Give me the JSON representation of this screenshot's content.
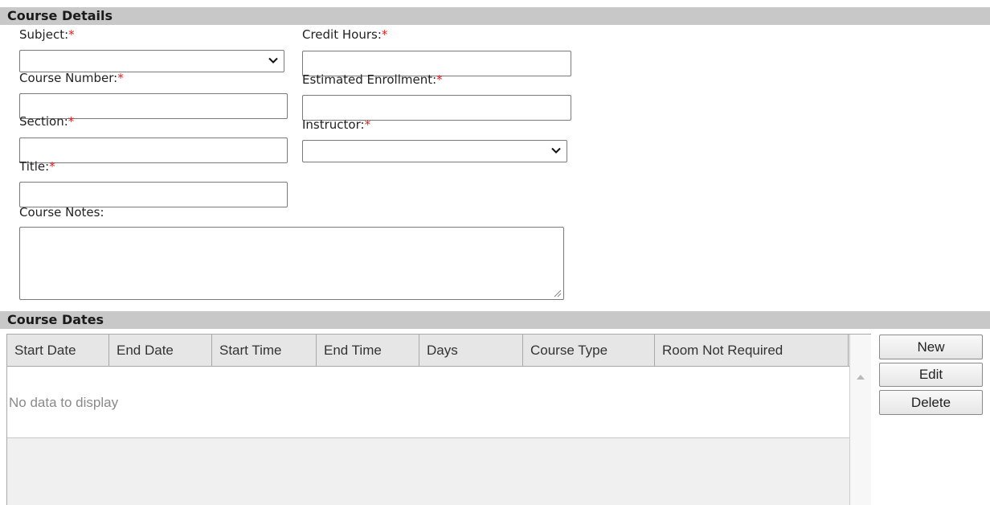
{
  "course_details": {
    "header": "Course Details",
    "required_marker": "*",
    "subject": {
      "label": "Subject:",
      "value": ""
    },
    "course_number": {
      "label": "Course Number:",
      "value": ""
    },
    "section": {
      "label": "Section:",
      "value": ""
    },
    "title": {
      "label": "Title:",
      "value": ""
    },
    "course_notes": {
      "label": "Course Notes:",
      "value": ""
    },
    "credit_hours": {
      "label": "Credit Hours:",
      "value": ""
    },
    "estimated_enrollment": {
      "label": "Estimated Enrollment:",
      "value": ""
    },
    "instructor": {
      "label": "Instructor:",
      "value": ""
    }
  },
  "course_dates": {
    "header": "Course Dates",
    "columns": [
      "Start Date",
      "End Date",
      "Start Time",
      "End Time",
      "Days",
      "Course Type",
      "Room Not Required"
    ],
    "empty_text": "No data to display",
    "buttons": {
      "new": "New",
      "edit": "Edit",
      "delete": "Delete"
    }
  },
  "icons": {
    "dropdown": "chevron-down-icon",
    "resize": "resize-grip-icon",
    "scroll_up": "scroll-up-arrow-icon"
  },
  "colors": {
    "section_header_bg": "#c8c8c8",
    "required": "#e02020",
    "empty_text": "#8a8a8a",
    "grid_header_bg": "#e6e6e6"
  }
}
